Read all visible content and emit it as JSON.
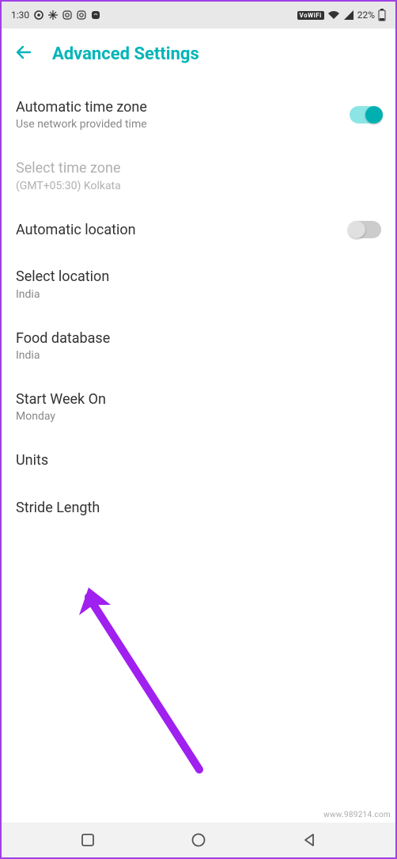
{
  "status": {
    "time": "1:30",
    "vowifi": "VoWiFi",
    "battery": "22%"
  },
  "header": {
    "title": "Advanced Settings"
  },
  "settings": {
    "auto_tz": {
      "title": "Automatic time zone",
      "sub": "Use network provided time"
    },
    "select_tz": {
      "title": "Select time zone",
      "sub": "(GMT+05:30) Kolkata"
    },
    "auto_loc": {
      "title": "Automatic location"
    },
    "select_loc": {
      "title": "Select location",
      "sub": "India"
    },
    "food_db": {
      "title": "Food database",
      "sub": "India"
    },
    "start_week": {
      "title": "Start Week On",
      "sub": "Monday"
    },
    "units": {
      "title": "Units"
    },
    "stride": {
      "title": "Stride Length"
    }
  },
  "watermark": "www.989214.com"
}
